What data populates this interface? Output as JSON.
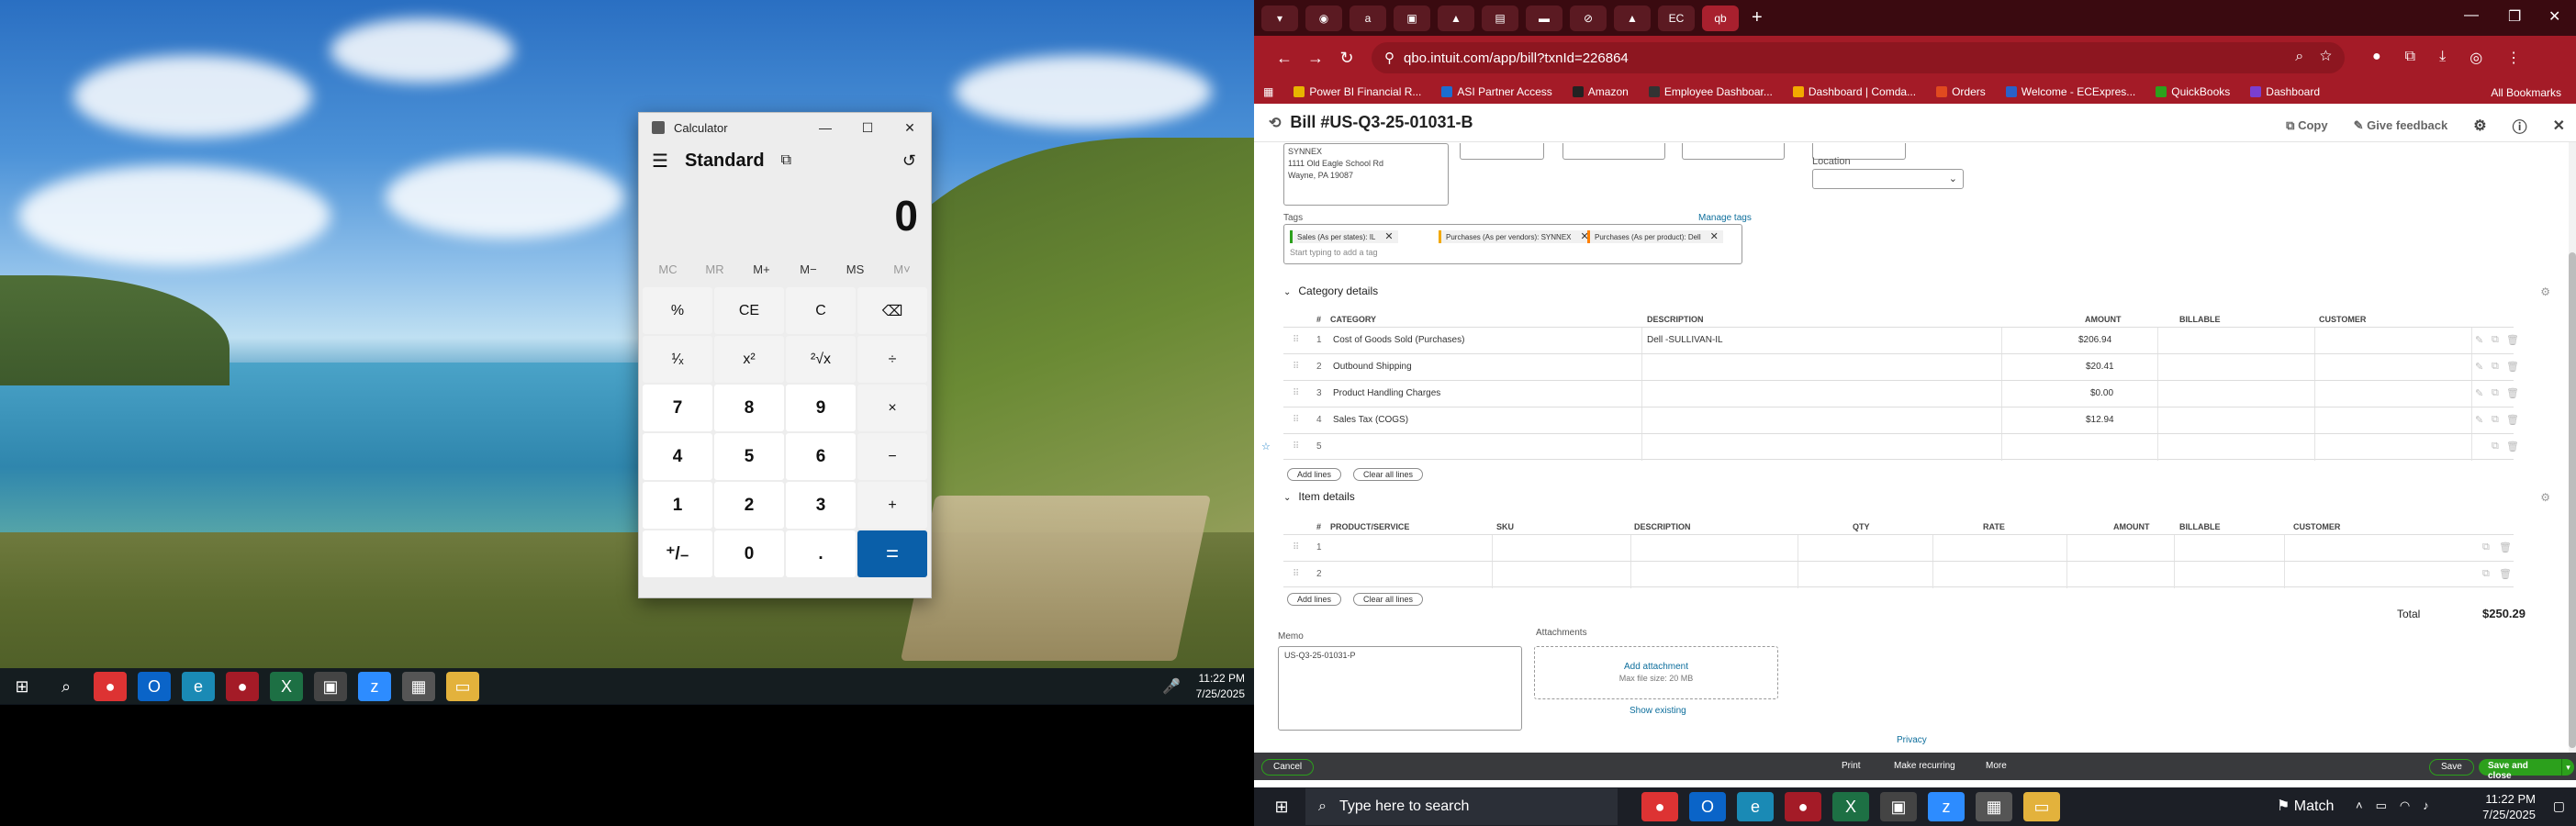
{
  "calculator": {
    "title": "Calculator",
    "mode": "Standard",
    "display": "0",
    "memory": [
      "MC",
      "MR",
      "M+",
      "M−",
      "MS",
      "M˅"
    ],
    "keys": [
      "%",
      "CE",
      "C",
      "⌫",
      "¹⁄ₓ",
      "x²",
      "²√x",
      "÷",
      "7",
      "8",
      "9",
      "×",
      "4",
      "5",
      "6",
      "−",
      "1",
      "2",
      "3",
      "+",
      "⁺/₋",
      "0",
      ".",
      "="
    ],
    "win_buttons": [
      "—",
      "☐",
      "✕"
    ]
  },
  "left_taskbar": {
    "time": "11:22 PM",
    "date": "7/25/2025"
  },
  "browser": {
    "url": "qbo.intuit.com/app/bill?txnId=226864",
    "bookmarks": [
      {
        "label": "Power BI Financial R...",
        "color": "#e8b400"
      },
      {
        "label": "ASI Partner Access",
        "color": "#1c6dd0"
      },
      {
        "label": "Amazon",
        "color": "#222222"
      },
      {
        "label": "Employee Dashboar...",
        "color": "#333333"
      },
      {
        "label": "Dashboard | Comda...",
        "color": "#f2a900"
      },
      {
        "label": "Orders",
        "color": "#e04a1f"
      },
      {
        "label": "Welcome - ECExpres...",
        "color": "#2a61c9"
      },
      {
        "label": "QuickBooks",
        "color": "#2ca01c"
      },
      {
        "label": "Dashboard",
        "color": "#7a3fd1"
      }
    ],
    "all_bookmarks": "All Bookmarks"
  },
  "bill": {
    "title": "Bill #US-Q3-25-01031-B",
    "header_actions": [
      "Copy",
      "Give feedback"
    ],
    "vendor_address": [
      "SYNNEX",
      "1111 Old Eagle School Rd",
      "Wayne, PA 19087"
    ],
    "location_label": "Location",
    "tags_label": "Tags",
    "manage_tags": "Manage tags",
    "tags": [
      {
        "label": "Sales (As per states): IL",
        "color": "#2ca01c"
      },
      {
        "label": "Purchases (As per vendors): SYNNEX",
        "color": "#f2a900"
      },
      {
        "label": "Purchases (As per product): Dell",
        "color": "#ff8000"
      }
    ],
    "tags_hint": "Start typing to add a tag",
    "category_section": "Category details",
    "category_headers": [
      "#",
      "CATEGORY",
      "DESCRIPTION",
      "AMOUNT",
      "BILLABLE",
      "CUSTOMER"
    ],
    "category_rows": [
      {
        "num": "1",
        "category": "Cost of Goods Sold (Purchases)",
        "description": "Dell -SULLIVAN-IL",
        "amount": "$206.94"
      },
      {
        "num": "2",
        "category": "Outbound Shipping",
        "description": "",
        "amount": "$20.41"
      },
      {
        "num": "3",
        "category": "Product Handling Charges",
        "description": "",
        "amount": "$0.00"
      },
      {
        "num": "4",
        "category": "Sales Tax (COGS)",
        "description": "",
        "amount": "$12.94"
      },
      {
        "num": "5",
        "category": "",
        "description": "",
        "amount": ""
      }
    ],
    "add_lines": "Add lines",
    "clear_lines": "Clear all lines",
    "item_section": "Item details",
    "item_headers": [
      "#",
      "PRODUCT/SERVICE",
      "SKU",
      "DESCRIPTION",
      "QTY",
      "RATE",
      "AMOUNT",
      "BILLABLE",
      "CUSTOMER"
    ],
    "item_rows": [
      {
        "num": "1"
      },
      {
        "num": "2"
      }
    ],
    "total_label": "Total",
    "total_value": "$250.29",
    "memo_label": "Memo",
    "memo_value": "US-Q3-25-01031-P",
    "attachments_label": "Attachments",
    "add_attachment": "Add attachment",
    "max_file": "Max file size: 20 MB",
    "show_existing": "Show existing",
    "privacy": "Privacy",
    "footer": {
      "cancel": "Cancel",
      "print": "Print",
      "make_recurring": "Make recurring",
      "more": "More",
      "save": "Save",
      "save_close": "Save and close"
    }
  },
  "right_taskbar": {
    "search_placeholder": "Type here to search",
    "weather": "Match",
    "time": "11:22 PM",
    "date": "7/25/2025"
  }
}
